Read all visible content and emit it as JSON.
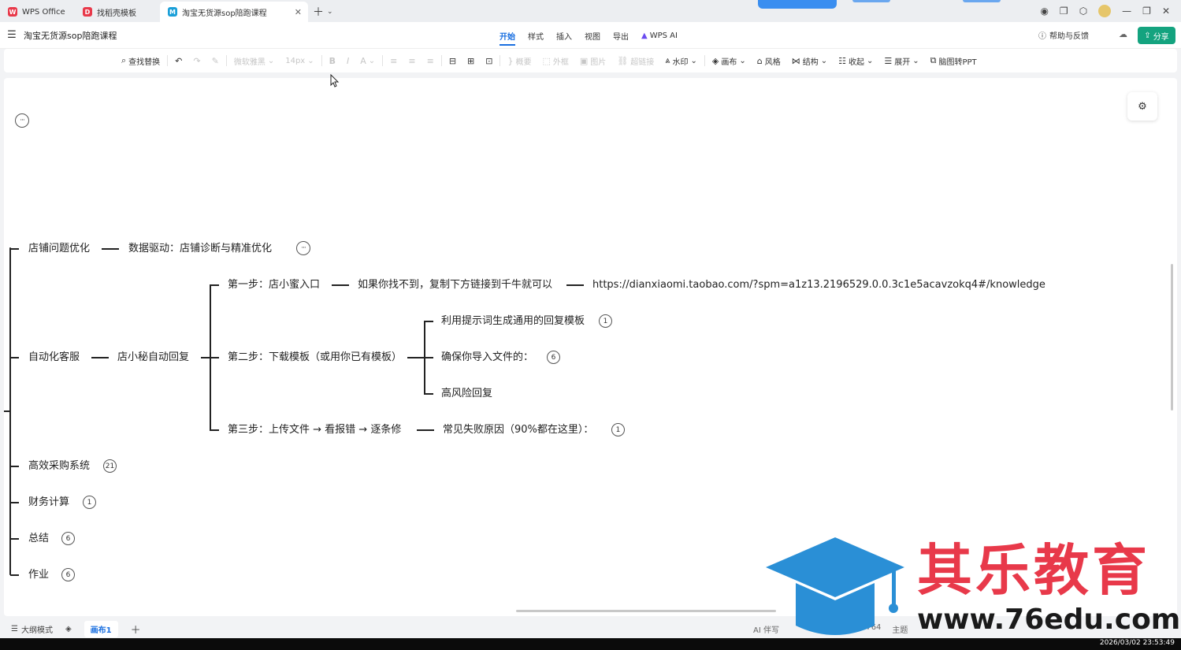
{
  "tabs": [
    {
      "label": "WPS Office",
      "logo": "W",
      "color": "#e8394a"
    },
    {
      "label": "找稻壳模板",
      "logo": "D",
      "color": "#e8394a"
    },
    {
      "label": "淘宝无货源sop陪跑课程",
      "logo": "M",
      "color": "#1a9fd8"
    }
  ],
  "titlebar": {
    "doc_title": "淘宝无货源sop陪跑课程",
    "menu": [
      "开始",
      "样式",
      "插入",
      "视图",
      "导出"
    ],
    "ai_label": "WPS AI",
    "help": "帮助与反馈",
    "share": "分享"
  },
  "toolbar": {
    "find_replace": "查找替换",
    "font": "微软雅黑",
    "font_size": "14px",
    "summary": "概要",
    "frame": "外框",
    "image": "图片",
    "hyperlink": "超链接",
    "watermark": "水印",
    "canvas": "画布",
    "style": "风格",
    "structure": "结构",
    "collapse": "收起",
    "expand": "展开",
    "to_ppt": "脑图转PPT"
  },
  "mindmap": {
    "n1": "店铺问题优化",
    "n1_child": "数据驱动：店铺诊断与精准优化",
    "n2": "自动化客服",
    "n2_child": "店小秘自动回复",
    "step1": "第一步：店小蜜入口",
    "step1_child": "如果你找不到，复制下方链接到千牛就可以",
    "step1_link": "https://dianxiaomi.taobao.com/?spm=a1z13.2196529.0.0.3c1e5acavzokq4#/knowledge",
    "step2": "第二步：下载模板（或用你已有模板）",
    "step2_a": "利用提示词生成通用的回复模板",
    "step2_a_badge": "1",
    "step2_b": "确保你导入文件的：",
    "step2_b_badge": "6",
    "step2_c": "高风险回复",
    "step3": "第三步：上传文件 → 看报错 → 逐条修",
    "step3_child": "常见失败原因（90%都在这里）：",
    "step3_badge": "1",
    "n3": "高效采购系统",
    "n3_badge": "21",
    "n4": "财务计算",
    "n4_badge": "1",
    "n5": "总结",
    "n5_badge": "6",
    "n6": "作业",
    "n6_badge": "6"
  },
  "statusbar": {
    "outline": "大纲模式",
    "page": "画布1",
    "ai_write": "AI 伴写",
    "word_count_fragment": "3764",
    "theme_fragment": "主题"
  },
  "watermark": {
    "brand": "其乐教育",
    "url": "www.76edu.com"
  },
  "taskbar": {
    "clock": "2026/03/02 23:53:49"
  }
}
